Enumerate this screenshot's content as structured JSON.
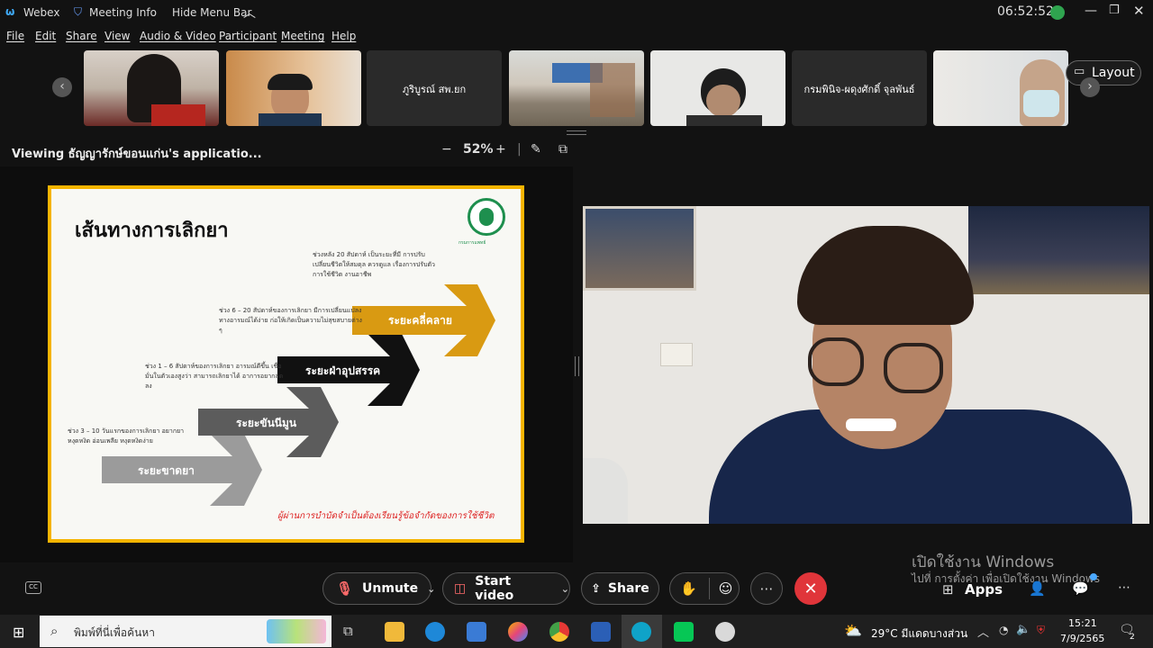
{
  "titlebar": {
    "app_name": "Webex",
    "meeting_info": "Meeting Info",
    "hide_menu": "Hide Menu Bar",
    "clock": "06:52:52"
  },
  "menu": [
    "File",
    "Edit",
    "Share",
    "View",
    "Audio & Video",
    "Participant",
    "Meeting",
    "Help"
  ],
  "participants": [
    {
      "name": ""
    },
    {
      "name": ""
    },
    {
      "name": "ภูริบูรณ์ สพ.ยก"
    },
    {
      "name": ""
    },
    {
      "name": ""
    },
    {
      "name": "กรมพินิจ-ผดุงศักดิ์ จุลพันธ์"
    },
    {
      "name": ""
    }
  ],
  "layout_label": "Layout",
  "viewing": "Viewing ธัญญารักษ์ขอนแก่น's applicatio...",
  "zoom": {
    "minus": "−",
    "value": "52%",
    "plus": "+"
  },
  "slide": {
    "title": "เส้นทางการเลิกยา",
    "org_text": "กรมการแพทย์",
    "stages": [
      "ระยะขาดยา",
      "ระยะขันนีมูน",
      "ระยะฝ่าอุปสรรค",
      "ระยะคลี่คลาย"
    ],
    "notes": [
      "ช่วง 3 – 10 วันแรกของการเลิกยา อยากยา หงุดหงิด อ่อนเพลีย หงุดหงิดง่าย",
      "ช่วง 1 – 6 สัปดาห์ของการเลิกยา อารมณ์ดีขึ้น เชื่อมั่นในตัวเองสูงว่า สามารถเลิกยาได้ อาการอยากลดลง",
      "ช่วง 6 – 20 สัปดาห์ของการเลิกยา มีการเปลี่ยนแปลงทางอารมณ์ได้ง่าย ก่อให้เกิดเป็นความไม่สุขสบายต่าง ๆ",
      "ช่วงหลัง 20 สัปดาห์ เป็นระยะที่มี การปรับเปลี่ยนชีวิตให้สมดุล ควรดูแล เรื่องการปรับตัว การใช้ชีวิต งานอาชีพ"
    ],
    "footer": "ผู้ผ่านการบำบัดจำเป็นต้องเรียนรู้ข้อจำกัดของการใช้ชีวิต"
  },
  "controls": {
    "unmute": "Unmute",
    "start_video": "Start video",
    "share": "Share",
    "apps": "Apps"
  },
  "watermark": {
    "line1": "เปิดใช้งาน Windows",
    "line2": "ไปที่ การตั้งค่า เพื่อเปิดใช้งาน Windows"
  },
  "taskbar": {
    "search_placeholder": "พิมพ์ที่นี่เพื่อค้นหา",
    "weather": "29°C มีแดดบางส่วน",
    "time": "15:21",
    "date": "7/9/2565",
    "notif_count": "2"
  },
  "colors": {
    "accent": "#f5b400",
    "end_call": "#e0353a",
    "stage1": "#9b9b9b",
    "stage2": "#5c5c5c",
    "stage3": "#111111",
    "stage4": "#d99a12"
  }
}
